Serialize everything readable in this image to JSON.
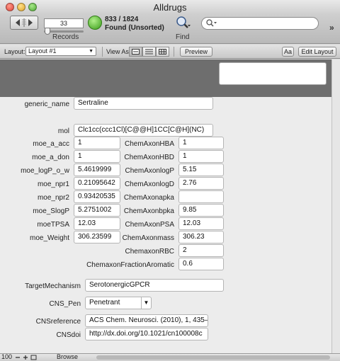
{
  "window": {
    "title": "Alldrugs"
  },
  "toolbar": {
    "record_number": "33",
    "records_label": "Records",
    "found_count": "833 / 1824",
    "found_status": "Found (Unsorted)",
    "find_label": "Find",
    "search_placeholder": ""
  },
  "layoutbar": {
    "layout_label": "Layout:",
    "layout_value": "Layout #1",
    "view_as_label": "View As:",
    "preview_label": "Preview",
    "aa_label": "Aa",
    "edit_layout_label": "Edit Layout"
  },
  "form": {
    "generic_name": {
      "label": "generic_name",
      "value": "Sertraline"
    },
    "mol": {
      "label": "mol",
      "value": "Clc1cc(ccc1Cl)[C@@H]1CC[C@H](NC)"
    },
    "left_fields": [
      {
        "label": "moe_a_acc",
        "value": "1"
      },
      {
        "label": "moe_a_don",
        "value": "1"
      },
      {
        "label": "moe_logP_o_w",
        "value": "5.4619999"
      },
      {
        "label": "moe_npr1",
        "value": "0.21095642"
      },
      {
        "label": "moe_npr2",
        "value": "0.93420535"
      },
      {
        "label": "moe_SlogP",
        "value": "5.2751002"
      },
      {
        "label": "moeTPSA",
        "value": "12.03"
      },
      {
        "label": "moe_Weight",
        "value": "306.23599"
      }
    ],
    "right_fields": [
      {
        "label": "ChemAxonHBA",
        "value": "1"
      },
      {
        "label": "ChemAxonHBD",
        "value": "1"
      },
      {
        "label": "ChemAxonlogP",
        "value": "5.15"
      },
      {
        "label": "ChemAxonlogD",
        "value": "2.76"
      },
      {
        "label": "ChemAxonapka",
        "value": ""
      },
      {
        "label": "ChemAxonbpka",
        "value": "9.85"
      },
      {
        "label": "ChemAxonPSA",
        "value": "12.03"
      },
      {
        "label": "ChemAxonmass",
        "value": "306.23"
      },
      {
        "label": "ChemaxonRBC",
        "value": "2"
      },
      {
        "label": "ChemaxonFractionAromatic",
        "value": "0.6"
      }
    ],
    "target_mechanism": {
      "label": "TargetMechanism",
      "value": "SerotonergicGPCR"
    },
    "cns_pen": {
      "label": "CNS_Pen",
      "value": "Penetrant"
    },
    "cns_reference": {
      "label": "CNSreference",
      "value": "ACS Chem. Neurosci. (2010), 1, 435–"
    },
    "cns_doi": {
      "label": "CNSdoi",
      "value": "http://dx.doi.org/10.1021/cn100008c"
    }
  },
  "statusbar": {
    "zoom": "100",
    "mode": "Browse"
  }
}
